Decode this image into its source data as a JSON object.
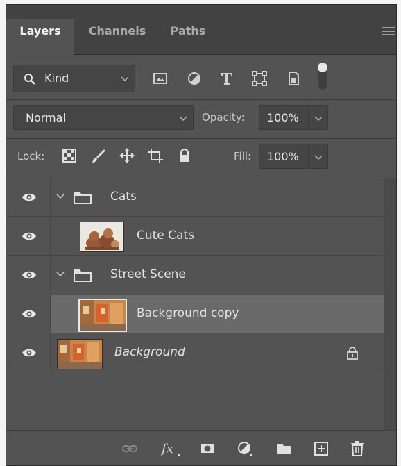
{
  "tabs": [
    {
      "label": "Layers",
      "active": true
    },
    {
      "label": "Channels",
      "active": false
    },
    {
      "label": "Paths",
      "active": false
    }
  ],
  "filter": {
    "kind_label": "Kind",
    "icons": [
      "pixel-filter-icon",
      "adjustment-filter-icon",
      "type-filter-icon",
      "shape-filter-icon",
      "smart-object-filter-icon",
      "filter-toggle-icon"
    ]
  },
  "blend": {
    "mode": "Normal",
    "opacity_label": "Opacity:",
    "opacity_value": "100%"
  },
  "lock": {
    "label": "Lock:",
    "fill_label": "Fill:",
    "fill_value": "100%",
    "icons": [
      "lock-transparent-icon",
      "lock-image-icon",
      "lock-position-icon",
      "lock-artboard-icon",
      "lock-all-icon"
    ]
  },
  "layers": [
    {
      "name": "Cats",
      "type": "group",
      "expanded": true,
      "visible": true
    },
    {
      "name": "Cute Cats",
      "type": "layer",
      "visible": true,
      "thumb": "cats"
    },
    {
      "name": "Street Scene",
      "type": "group",
      "expanded": true,
      "visible": true
    },
    {
      "name": "Background copy",
      "type": "layer",
      "visible": true,
      "selected": true,
      "thumb": "street"
    },
    {
      "name": "Background",
      "type": "background",
      "visible": true,
      "italic": true,
      "locked": true,
      "thumb": "street"
    }
  ],
  "bottom_icons": [
    "link-layers-icon",
    "fx-icon",
    "layer-mask-icon",
    "adjustment-layer-icon",
    "new-group-icon",
    "new-layer-icon",
    "delete-icon"
  ],
  "colors": {
    "panel": "#535353",
    "tabbar": "#424242",
    "selected_row": "#6a6a6a",
    "field": "#454545"
  }
}
